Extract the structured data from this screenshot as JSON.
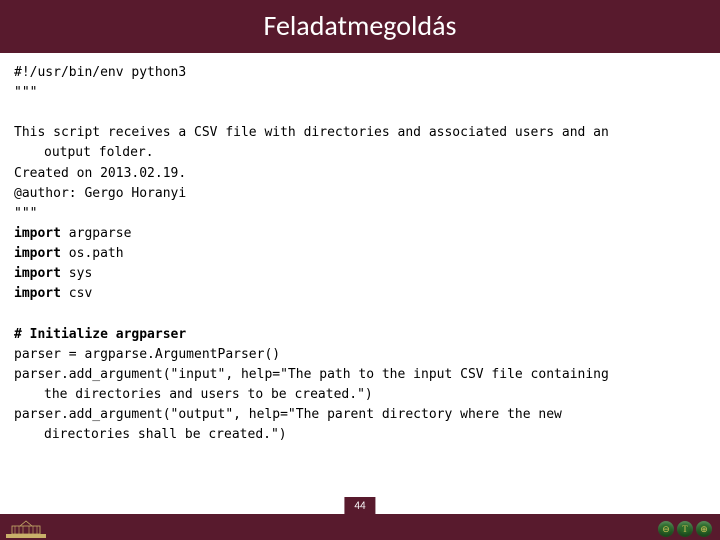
{
  "title": "Feladatmegoldás",
  "code": {
    "shebang": "#!/usr/bin/env python3",
    "docopen": "\"\"\"",
    "desc_l1": "This script receives a CSV file with directories and associated users and an",
    "desc_l2": "output folder.",
    "created": "Created on 2013.02.19.",
    "author": "@author: Gergo Horanyi",
    "docclose": "\"\"\"",
    "kw_import": "import",
    "mod1": " argparse",
    "mod2": " os.path",
    "mod3": " sys",
    "mod4": " csv",
    "comment1": "# Initialize argparser",
    "p1": "parser = argparse.ArgumentParser()",
    "p2a": "parser.add_argument(\"input\", help=\"The path to the input CSV file containing",
    "p2b": "the directories and users to be created.\")",
    "p3a": "parser.add_argument(\"output\", help=\"The parent directory where the new",
    "p3b": "directories shall be created.\")"
  },
  "page_number": "44",
  "footer_icons": [
    "⊖",
    "T",
    "⊕"
  ]
}
